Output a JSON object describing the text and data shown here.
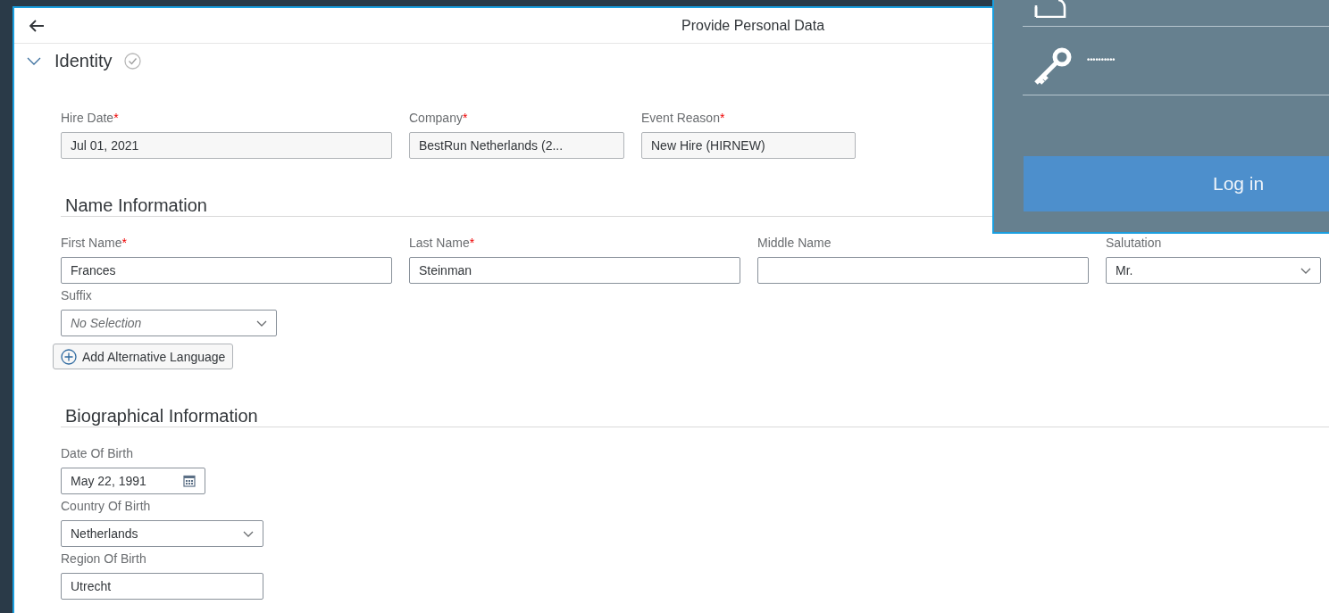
{
  "window": {
    "title": "Provide Personal Data"
  },
  "section": {
    "title": "Identity",
    "expanded": true,
    "complete": true
  },
  "identity_fields": [
    {
      "label": "Hire Date",
      "required_mark": "*",
      "value": "Jul 01, 2021",
      "kind": "text",
      "readonly": true
    },
    {
      "label": "Company",
      "required_mark": "*",
      "value": "BestRun Netherlands (2...",
      "kind": "text",
      "readonly": true
    },
    {
      "label": "Event Reason",
      "required_mark": "*",
      "value": "New Hire (HIRNEW)",
      "kind": "text",
      "readonly": true
    }
  ],
  "groups": [
    {
      "title": "Name Information",
      "fields": [
        {
          "label": "First Name",
          "required_mark": "*",
          "value": "Frances",
          "kind": "text",
          "readonly": false
        },
        {
          "label": "Last Name",
          "required_mark": "*",
          "value": "Steinman",
          "kind": "text",
          "readonly": false
        },
        {
          "label": "Middle Name",
          "kind": "text",
          "readonly": false
        },
        {
          "label": "Salutation",
          "value": "Mr.",
          "kind": "select",
          "readonly": false
        },
        {
          "label": "Suffix",
          "placeholder": "No Selection",
          "kind": "select",
          "readonly": false
        }
      ],
      "button": "Add Alternative Language"
    },
    {
      "title": "Biographical Information",
      "fields": [
        {
          "label": "Date Of Birth",
          "value": "May 22, 1991",
          "kind": "date",
          "readonly": false
        },
        {
          "label": "Country Of Birth",
          "value": "Netherlands",
          "kind": "select",
          "readonly": false
        },
        {
          "label": "Region Of Birth",
          "value": "Utrecht",
          "kind": "text",
          "readonly": false
        }
      ]
    }
  ],
  "login_overlay": {
    "password_mask": "••••••••••",
    "button": "Log in"
  }
}
